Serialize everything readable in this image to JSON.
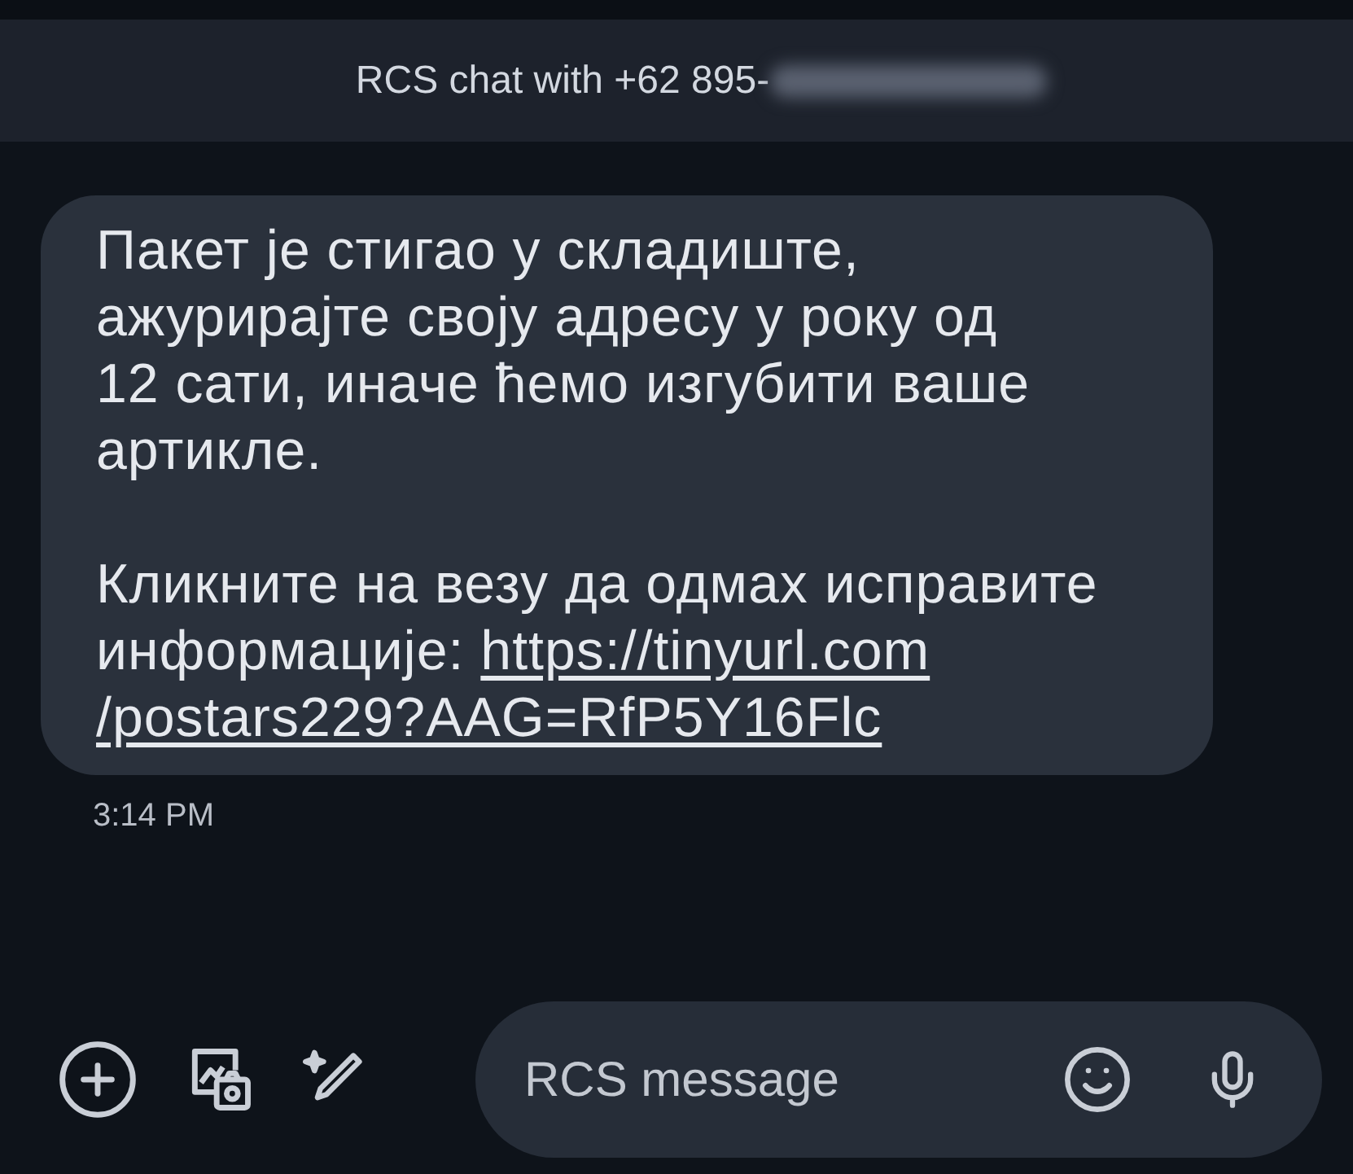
{
  "header": {
    "title": "RCS chat with +62 895-"
  },
  "message": {
    "paragraphs": [
      "Пакет је стигао у складиште,\nажурирајте своју адресу у року од\n12 сати, иначе ћемо изгубити ваше\nартикле."
    ],
    "link_intro": [
      "Кликните на везу да одмах исправите",
      "информације: "
    ],
    "link_lines": [
      "https://tinyurl.com",
      "/postars229?AAG=RfP5Y16Flc"
    ],
    "time": "3:14 PM"
  },
  "composer": {
    "placeholder": "RCS message"
  }
}
